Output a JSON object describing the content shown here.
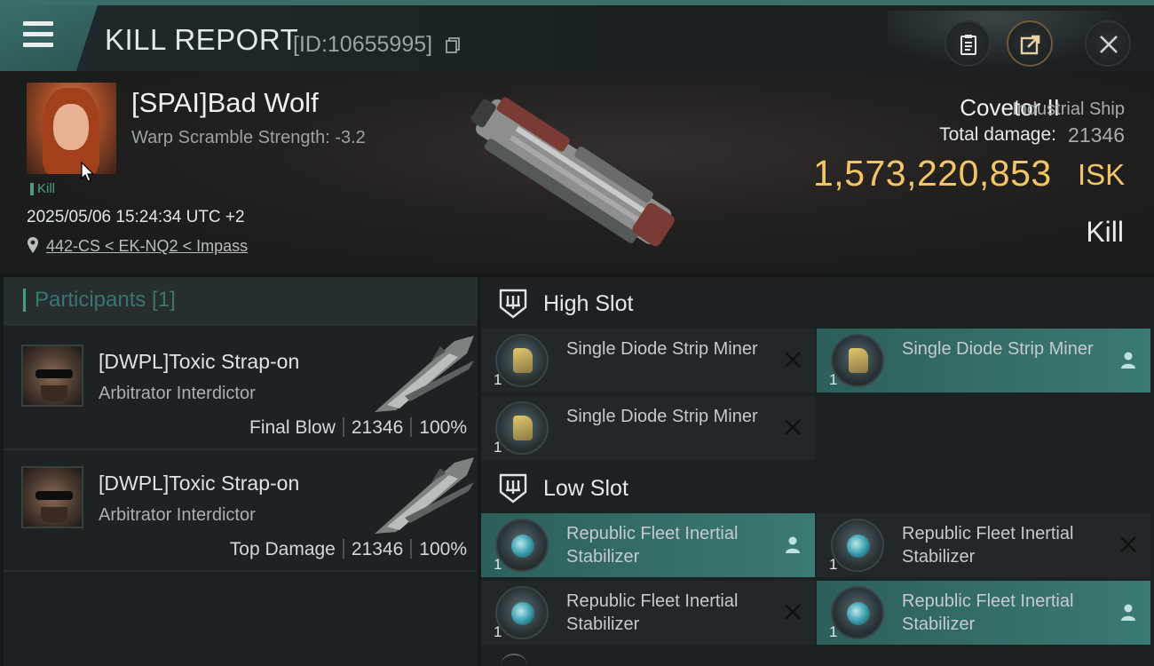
{
  "header": {
    "title": "KILL REPORT",
    "report_id": "[ID:10655995]",
    "icons": [
      "menu-icon",
      "copy-icon",
      "clipboard-icon",
      "share-icon",
      "close-icon"
    ]
  },
  "victim": {
    "name": "[SPAI]Bad Wolf",
    "warp_scramble": "Warp Scramble Strength: -3.2",
    "tag": "Kill",
    "timestamp": "2025/05/06 15:24:34 UTC +2",
    "location": "442-CS < EK-NQ2 < Impass",
    "ship_name": "Covetor II",
    "ship_class": "Industrial Ship",
    "total_damage_label": "Total damage:",
    "total_damage": "21346",
    "isk_value": "1,573,220,853",
    "isk_unit": "ISK",
    "result": "Kill"
  },
  "participants": {
    "label": "Participants [1]",
    "rows": [
      {
        "name": "[DWPL]Toxic Strap-on",
        "ship": "Arbitrator Interdictor",
        "role": "Final Blow",
        "damage": "21346",
        "percent": "100%"
      },
      {
        "name": "[DWPL]Toxic Strap-on",
        "ship": "Arbitrator Interdictor",
        "role": "Top Damage",
        "damage": "21346",
        "percent": "100%"
      }
    ]
  },
  "fitting": {
    "high_slot_label": "High Slot",
    "low_slot_label": "Low Slot",
    "high_modules": [
      {
        "qty": "1",
        "name": "Single Diode Strip Miner",
        "status": "destroyed"
      },
      {
        "qty": "1",
        "name": "Single Diode Strip Miner",
        "status": "dropped"
      },
      {
        "qty": "1",
        "name": "Single Diode Strip Miner",
        "status": "destroyed"
      }
    ],
    "low_modules": [
      {
        "qty": "1",
        "name": "Republic Fleet Inertial Stabilizer",
        "status": "dropped"
      },
      {
        "qty": "1",
        "name": "Republic Fleet Inertial Stabilizer",
        "status": "destroyed"
      },
      {
        "qty": "1",
        "name": "Republic Fleet Inertial Stabilizer",
        "status": "destroyed"
      },
      {
        "qty": "1",
        "name": "Republic Fleet Inertial Stabilizer",
        "status": "dropped"
      }
    ]
  },
  "colors": {
    "accent_teal": "#3b7a73",
    "isk_gold": "#f2c667",
    "panel_bg": "#1c2123"
  }
}
